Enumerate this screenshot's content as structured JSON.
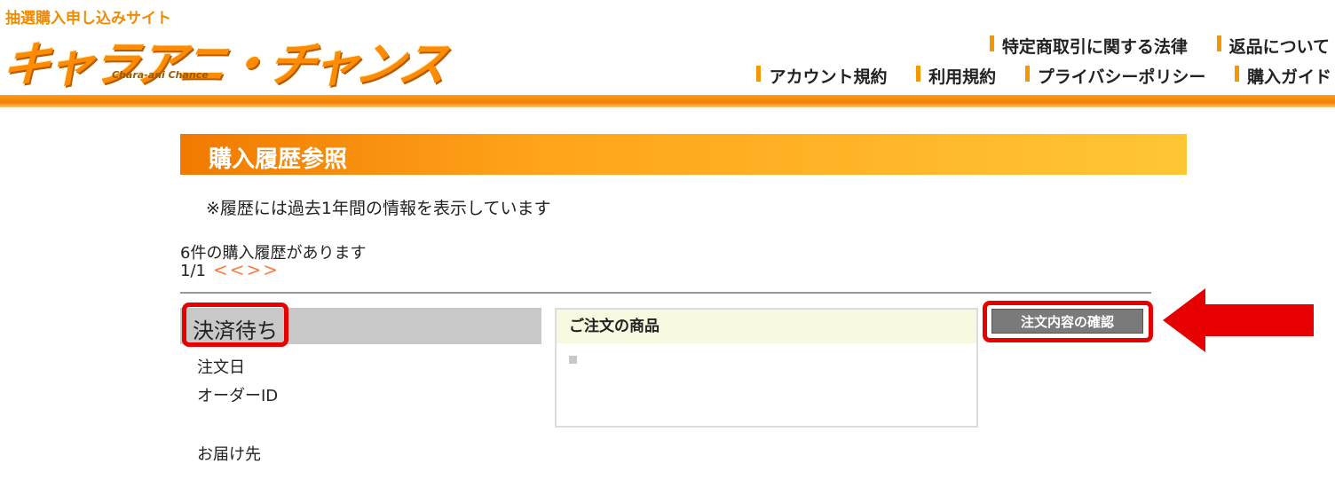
{
  "header": {
    "subtitle": "抽選購入申し込みサイト",
    "logo_text": "キャラアニ・チャンス",
    "logo_en": "Chara-ani Chance",
    "links_row1": [
      "特定商取引に関する法律",
      "返品について"
    ],
    "links_row2": [
      "アカウント規約",
      "利用規約",
      "プライバシーポリシー",
      "購入ガイド"
    ]
  },
  "page": {
    "title": "購入履歴参照",
    "notice": "※履歴には過去1年間の情報を表示しています",
    "count_text": "6件の購入履歴があります",
    "pager_text": "1/1",
    "pager_arrows": "<<>>"
  },
  "order": {
    "status": "決済待ち",
    "fields": [
      "注文日",
      "オーダーID",
      "お届け先"
    ],
    "products_header": "ご注文の商品",
    "confirm_button": "注文内容の確認"
  },
  "colors": {
    "accent_orange": "#f39800",
    "highlight_red": "#e60000"
  }
}
